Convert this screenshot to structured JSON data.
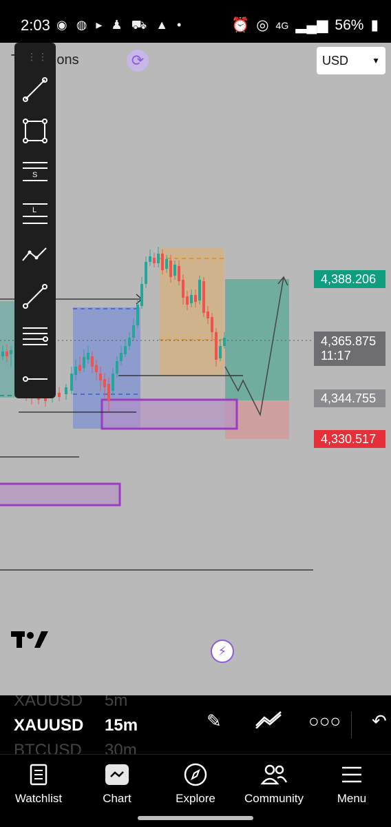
{
  "status": {
    "time": "2:03",
    "battery": "56%",
    "network": "4G"
  },
  "header": {
    "title": "T     Sessions",
    "currency": "USD"
  },
  "price_axis": {
    "take_profit": "4,388.206",
    "current_price": "4,365.875",
    "countdown": "11:17",
    "entry": "4,344.755",
    "stop_loss": "4,330.517"
  },
  "ticker": {
    "rows": [
      {
        "symbol": "XAUUSD",
        "interval": "5m"
      },
      {
        "symbol": "XAUUSD",
        "interval": "15m"
      },
      {
        "symbol": "BTCUSD",
        "interval": "30m"
      }
    ]
  },
  "nav": {
    "items": [
      {
        "label": "Watchlist",
        "icon": "document-icon"
      },
      {
        "label": "Chart",
        "icon": "chart-icon"
      },
      {
        "label": "Explore",
        "icon": "compass-icon"
      },
      {
        "label": "Community",
        "icon": "people-icon"
      },
      {
        "label": "Menu",
        "icon": "hamburger-icon"
      }
    ]
  },
  "colors": {
    "bull": "#26a69a",
    "bear": "#ef5350",
    "tp_tag": "#0f9d80",
    "sl_tag": "#e5303a",
    "neutral_tag": "#6e6e72",
    "zone_purple": "#9b3cc0"
  }
}
